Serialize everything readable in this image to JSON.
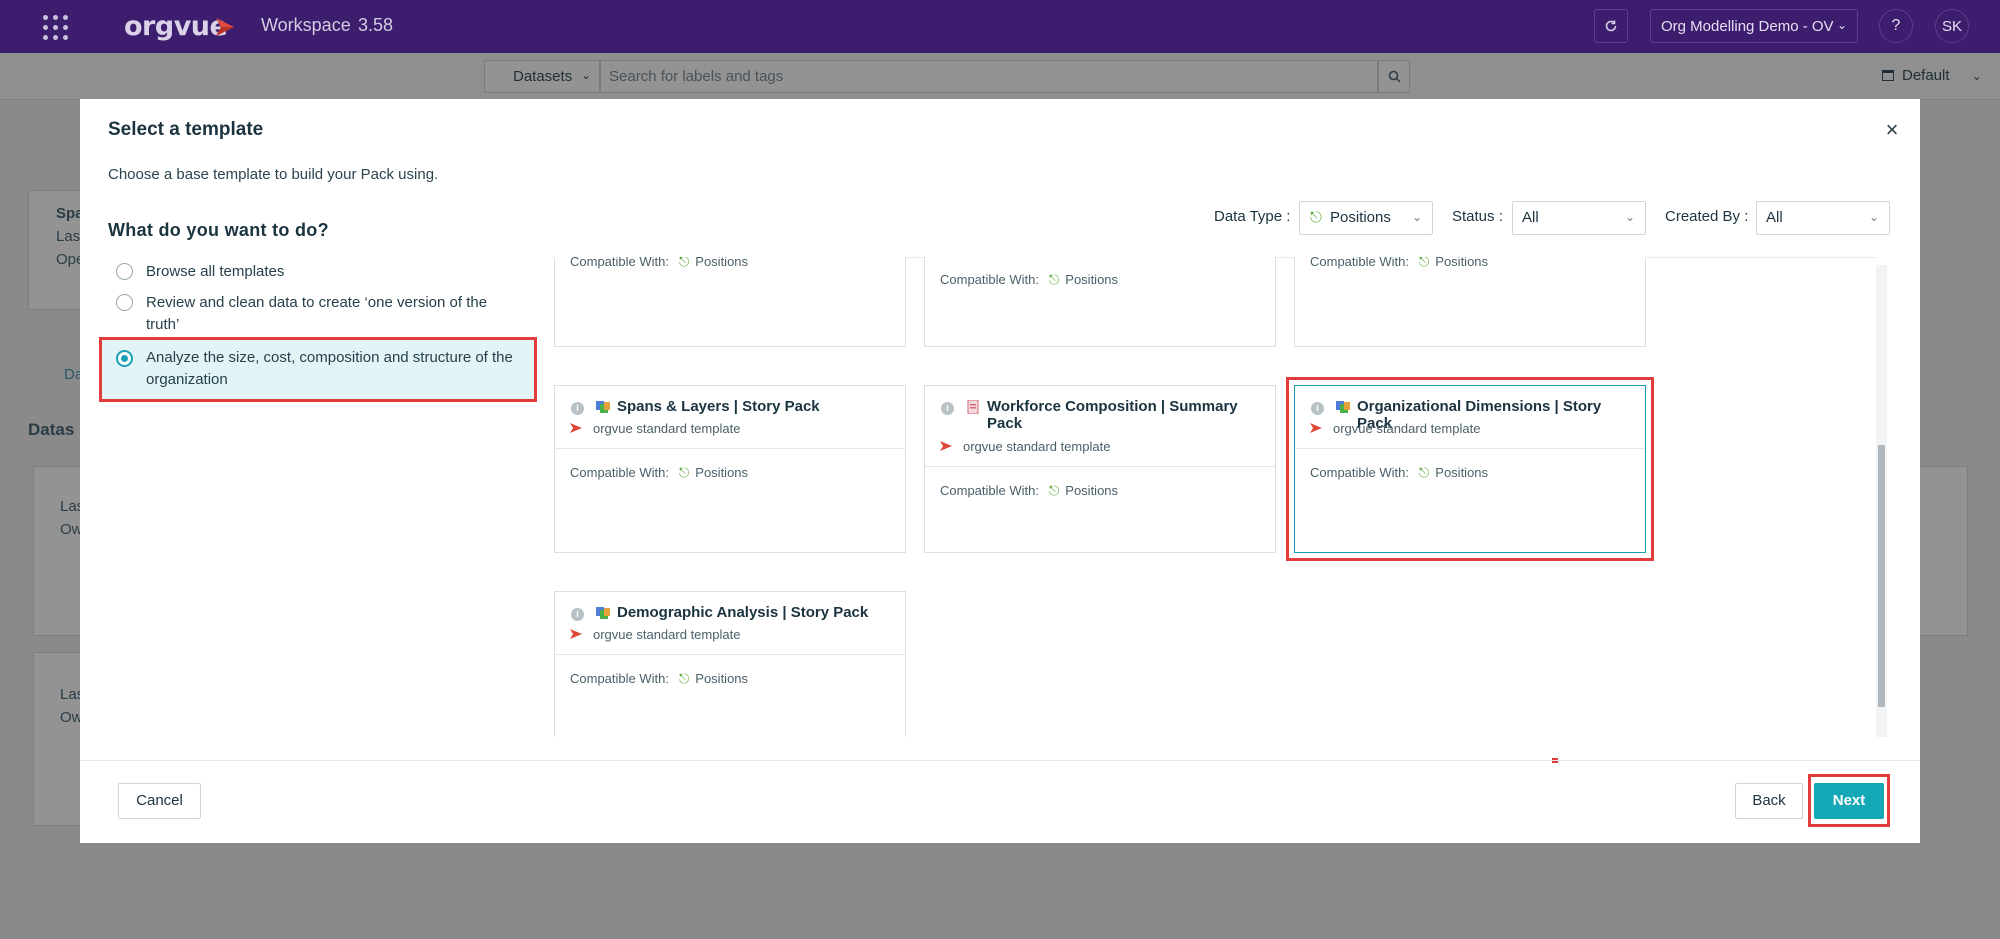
{
  "topbar": {
    "logo_text": "orgvue",
    "product": "Workspace",
    "version": "3.58",
    "org_name": "Org Modelling Demo - OV",
    "help_label": "?",
    "avatar_initials": "SK",
    "brand_color": "#3c1d6e"
  },
  "subbar": {
    "datasets_label": "Datasets",
    "search_placeholder": "Search for labels and tags",
    "view_label": "Default"
  },
  "background": {
    "card_lines": [
      "Spa",
      "Las",
      "Ope"
    ],
    "tab_label": "Da",
    "section_label": "Datas",
    "card2_lines": [
      "Las",
      "Ow"
    ],
    "card3_lines": [
      "Las",
      "Ow"
    ]
  },
  "modal": {
    "title": "Select a template",
    "close_label": "×",
    "subtitle": "Choose a base template to build your Pack using.",
    "question": "What do you want to do?",
    "filters": {
      "data_type_label": "Data Type :",
      "data_type_value": "Positions",
      "status_label": "Status :",
      "status_value": "All",
      "created_by_label": "Created By :",
      "created_by_value": "All"
    },
    "options": [
      {
        "label": "Browse all templates",
        "selected": false
      },
      {
        "label": "Review and clean data to create ‘one version of the truth’",
        "selected": false
      },
      {
        "label": "Analyze the size, cost, composition and structure of the organization",
        "selected": true
      }
    ],
    "compatible_label": "Compatible With:",
    "positions_label": "Positions",
    "source_label": "orgvue standard template",
    "tiles": [
      {
        "title": "Spans & Layers | Story Pack"
      },
      {
        "title": "Workforce Composition | Summary Pack"
      },
      {
        "title": "Organizational Dimensions | Story Pack"
      },
      {
        "title": "Demographic Analysis | Story Pack"
      }
    ],
    "buttons": {
      "cancel": "Cancel",
      "back": "Back",
      "next": "Next"
    },
    "accent_color": "#14a7b6",
    "highlight_color": "#e23d3d"
  }
}
